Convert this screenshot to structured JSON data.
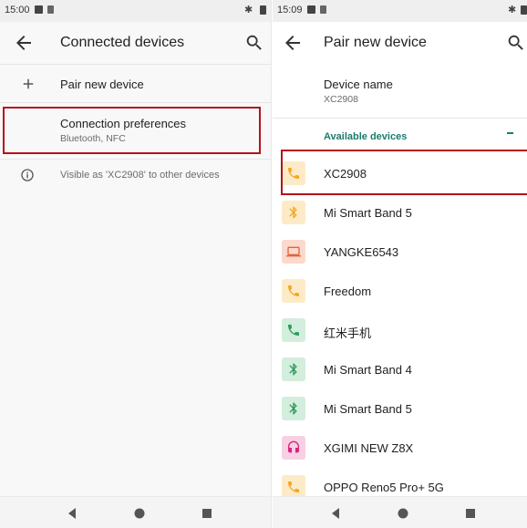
{
  "left": {
    "status": {
      "time": "15:00"
    },
    "title": "Connected devices",
    "items": [
      {
        "label": "Pair new device"
      },
      {
        "label": "Connection preferences",
        "subtitle": "Bluetooth, NFC"
      }
    ],
    "visibility_note": "Visible as 'XC2908' to other devices"
  },
  "right": {
    "status": {
      "time": "15:09"
    },
    "title": "Pair new device",
    "device_name": {
      "label": "Device name",
      "value": "XC2908"
    },
    "section_title": "Available devices",
    "devices": [
      {
        "name": "XC2908",
        "icon": "phone-icon",
        "icon_color": "#f6a623",
        "icon_bg": "#fdebc8"
      },
      {
        "name": "Mi Smart Band 5",
        "icon": "bluetooth-icon",
        "icon_color": "#f6a623",
        "icon_bg": "#fdebc8"
      },
      {
        "name": "YANGKE6543",
        "icon": "laptop-icon",
        "icon_color": "#e0663a",
        "icon_bg": "#fbd9cc"
      },
      {
        "name": "Freedom",
        "icon": "phone-icon",
        "icon_color": "#f6a623",
        "icon_bg": "#fdebc8"
      },
      {
        "name": "红米手机",
        "icon": "phone-icon",
        "icon_color": "#2e9a5c",
        "icon_bg": "#d3eedc"
      },
      {
        "name": "Mi Smart Band 4",
        "icon": "bluetooth-icon",
        "icon_color": "#2e9a5c",
        "icon_bg": "#d3eedc"
      },
      {
        "name": "Mi Smart Band 5",
        "icon": "bluetooth-icon",
        "icon_color": "#2e9a5c",
        "icon_bg": "#d3eedc"
      },
      {
        "name": "XGIMI NEW Z8X",
        "icon": "headset-icon",
        "icon_color": "#d6267f",
        "icon_bg": "#f8d0e4"
      },
      {
        "name": "OPPO Reno5 Pro+ 5G",
        "icon": "phone-icon",
        "icon_color": "#f6a623",
        "icon_bg": "#fdebc8"
      }
    ]
  },
  "colors": {
    "accent": "#1b7c6d",
    "highlight": "#b5121b"
  }
}
